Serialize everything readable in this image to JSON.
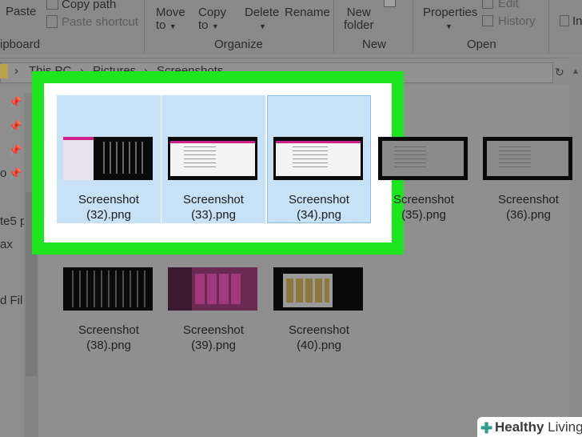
{
  "ribbon": {
    "clipboard": {
      "paste": "Paste",
      "copy_path": "Copy path",
      "paste_shortcut": "Paste shortcut",
      "group": "ipboard"
    },
    "organize": {
      "move_to": "Move",
      "move_to2": "to",
      "copy_to": "Copy",
      "copy_to2": "to",
      "delete": "Delete",
      "rename": "Rename",
      "group": "Organize"
    },
    "new": {
      "new_folder": "New",
      "new_folder2": "folder",
      "group": "New"
    },
    "open": {
      "properties": "Properties",
      "edit": "Edit",
      "history": "History",
      "group": "Open"
    },
    "select": {
      "item": "In"
    }
  },
  "address": {
    "crumbs": [
      "This PC",
      "Pictures",
      "Screenshots"
    ]
  },
  "nav": {
    "items": [
      "o",
      "te5 p",
      "ax",
      "d Fil"
    ]
  },
  "files": [
    {
      "name": "Screenshot",
      "ext": "(32).png"
    },
    {
      "name": "Screenshot",
      "ext": "(33).png"
    },
    {
      "name": "Screenshot",
      "ext": "(34).png"
    },
    {
      "name": "Screenshot",
      "ext": "(35).png"
    },
    {
      "name": "Screenshot",
      "ext": "(36).png"
    },
    {
      "name": "Screenshot",
      "ext": "(38).png"
    },
    {
      "name": "Screenshot",
      "ext": "(39).png"
    },
    {
      "name": "Screenshot",
      "ext": "(40).png"
    }
  ],
  "colors": {
    "highlight": "#1ee61e",
    "selection": "#c7e1f6",
    "logo_accent": "#2e9c8a"
  },
  "logo": {
    "brand1": "Healthy",
    "brand2": "Living"
  }
}
